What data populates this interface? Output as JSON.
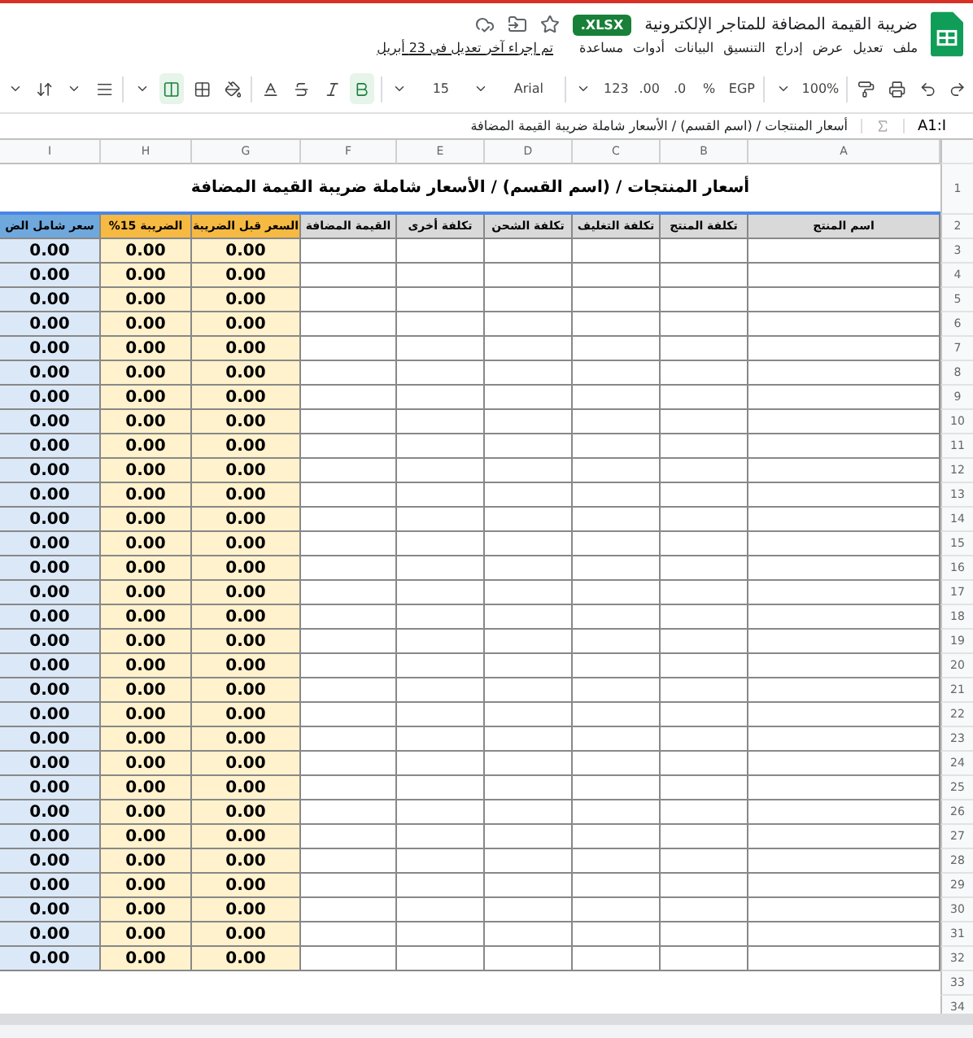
{
  "title_bar": {
    "title": "ضريبة القيمة المضافة للمتاجر الإلكترونية",
    "badge": ".XLSX",
    "menus": [
      "ملف",
      "تعديل",
      "عرض",
      "إدراج",
      "التنسيق",
      "البيانات",
      "أدوات",
      "مساعدة"
    ],
    "last_edit": "تم إجراء آخر تعديل في 23 أبريل"
  },
  "toolbar": {
    "font_size": "15",
    "font": "Arial",
    "formats": [
      "123",
      ".00",
      ".0",
      "%",
      "EGP"
    ],
    "zoom": "100%",
    "bold_on": true,
    "italic_on": false,
    "strike_on": false,
    "merge_on": true
  },
  "formula_bar": {
    "content": "أسعار المنتجات / (اسم القسم) / الأسعار شاملة ضريبة القيمة المضافة",
    "name_box": "A1:I"
  },
  "grid": {
    "columns": [
      "I",
      "H",
      "G",
      "F",
      "E",
      "D",
      "C",
      "B",
      "A"
    ],
    "title_row": {
      "number": "1",
      "text": "أسعار المنتجات / (اسم القسم) / الأسعار شاملة ضريبة القيمة المضافة"
    },
    "header_row": {
      "number": "2",
      "cells": [
        {
          "text": "اسم المنتج",
          "kind": "input"
        },
        {
          "text": "تكلفة المنتج",
          "kind": "input"
        },
        {
          "text": "تكلفة التغليف",
          "kind": "input"
        },
        {
          "text": "تكلفة الشحن",
          "kind": "input"
        },
        {
          "text": "تكلفة أخرى",
          "kind": "input"
        },
        {
          "text": "القيمة المضافة",
          "kind": "input"
        },
        {
          "text": "السعر قبل الضريبة",
          "kind": "tax"
        },
        {
          "text": "الضريبة 15%",
          "kind": "tax"
        },
        {
          "text": "سعر شامل الض",
          "kind": "total"
        }
      ]
    },
    "rows": [
      {
        "number": "3",
        "values": [
          "0.00",
          "0.00",
          "0.00"
        ]
      },
      {
        "number": "4",
        "values": [
          "0.00",
          "0.00",
          "0.00"
        ]
      },
      {
        "number": "5",
        "values": [
          "0.00",
          "0.00",
          "0.00"
        ]
      },
      {
        "number": "6",
        "values": [
          "0.00",
          "0.00",
          "0.00"
        ]
      },
      {
        "number": "7",
        "values": [
          "0.00",
          "0.00",
          "0.00"
        ]
      },
      {
        "number": "8",
        "values": [
          "0.00",
          "0.00",
          "0.00"
        ]
      },
      {
        "number": "9",
        "values": [
          "0.00",
          "0.00",
          "0.00"
        ]
      },
      {
        "number": "10",
        "values": [
          "0.00",
          "0.00",
          "0.00"
        ]
      },
      {
        "number": "11",
        "values": [
          "0.00",
          "0.00",
          "0.00"
        ]
      },
      {
        "number": "12",
        "values": [
          "0.00",
          "0.00",
          "0.00"
        ]
      },
      {
        "number": "13",
        "values": [
          "0.00",
          "0.00",
          "0.00"
        ]
      },
      {
        "number": "14",
        "values": [
          "0.00",
          "0.00",
          "0.00"
        ]
      },
      {
        "number": "15",
        "values": [
          "0.00",
          "0.00",
          "0.00"
        ]
      },
      {
        "number": "16",
        "values": [
          "0.00",
          "0.00",
          "0.00"
        ]
      },
      {
        "number": "17",
        "values": [
          "0.00",
          "0.00",
          "0.00"
        ]
      },
      {
        "number": "18",
        "values": [
          "0.00",
          "0.00",
          "0.00"
        ]
      },
      {
        "number": "19",
        "values": [
          "0.00",
          "0.00",
          "0.00"
        ]
      },
      {
        "number": "20",
        "values": [
          "0.00",
          "0.00",
          "0.00"
        ]
      },
      {
        "number": "21",
        "values": [
          "0.00",
          "0.00",
          "0.00"
        ]
      },
      {
        "number": "22",
        "values": [
          "0.00",
          "0.00",
          "0.00"
        ]
      },
      {
        "number": "23",
        "values": [
          "0.00",
          "0.00",
          "0.00"
        ]
      },
      {
        "number": "24",
        "values": [
          "0.00",
          "0.00",
          "0.00"
        ]
      },
      {
        "number": "25",
        "values": [
          "0.00",
          "0.00",
          "0.00"
        ]
      },
      {
        "number": "26",
        "values": [
          "0.00",
          "0.00",
          "0.00"
        ]
      },
      {
        "number": "27",
        "values": [
          "0.00",
          "0.00",
          "0.00"
        ]
      },
      {
        "number": "28",
        "values": [
          "0.00",
          "0.00",
          "0.00"
        ]
      },
      {
        "number": "29",
        "values": [
          "0.00",
          "0.00",
          "0.00"
        ]
      },
      {
        "number": "30",
        "values": [
          "0.00",
          "0.00",
          "0.00"
        ]
      },
      {
        "number": "31",
        "values": [
          "0.00",
          "0.00",
          "0.00"
        ]
      },
      {
        "number": "32",
        "values": [
          "0.00",
          "0.00",
          "0.00"
        ]
      }
    ],
    "empty_rows": [
      "33",
      "34"
    ]
  }
}
